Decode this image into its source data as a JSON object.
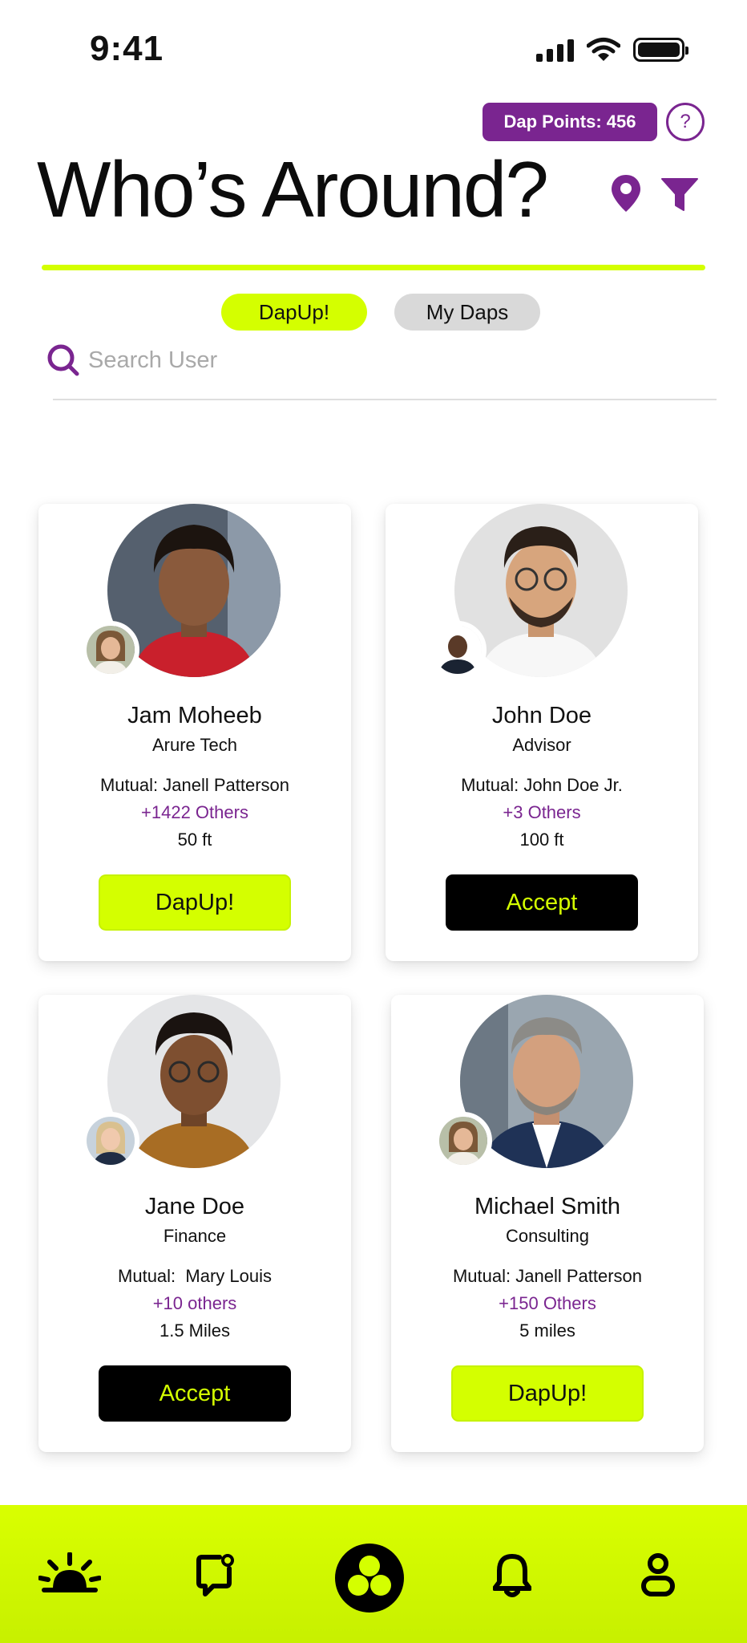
{
  "status_bar": {
    "time": "9:41"
  },
  "header": {
    "points_label": "Dap Points: 456",
    "help_label": "?",
    "title": "Who’s Around?"
  },
  "colors": {
    "accent": "#d4ff00",
    "brand": "#7a2590",
    "button_dark": "#000000"
  },
  "tabs": [
    {
      "label": "DapUp!",
      "active": true
    },
    {
      "label": "My Daps",
      "active": false
    }
  ],
  "search": {
    "placeholder": "Search User",
    "value": ""
  },
  "cards": [
    {
      "name": "Jam Moheeb",
      "company": "Arure Tech",
      "mutual": "Mutual: Janell Patterson",
      "others": "+1422 Others",
      "distance": "50 ft",
      "button": "DapUp!"
    },
    {
      "name": "John Doe",
      "company": "Advisor",
      "mutual": "Mutual: John Doe Jr.",
      "others": "+3 Others",
      "distance": "100 ft",
      "button": "Accept"
    },
    {
      "name": "Jane Doe",
      "company": "Finance",
      "mutual": "Mutual:  Mary Louis",
      "others": "+10 others",
      "distance": "1.5 Miles",
      "button": "Accept"
    },
    {
      "name": "Michael Smith",
      "company": "Consulting",
      "mutual": "Mutual: Janell Patterson",
      "others": "+150 Others",
      "distance": "5 miles",
      "button": "DapUp!"
    }
  ],
  "bottom_nav": [
    {
      "icon": "sunrise-icon"
    },
    {
      "icon": "chat-notification-icon"
    },
    {
      "icon": "dap-logo-icon"
    },
    {
      "icon": "bell-icon"
    },
    {
      "icon": "profile-icon"
    }
  ]
}
